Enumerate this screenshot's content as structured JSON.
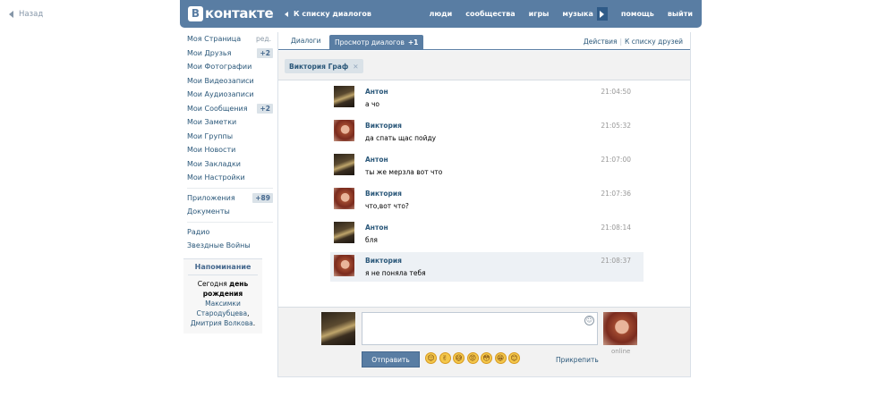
{
  "back": {
    "label": "Назад"
  },
  "header": {
    "logo_letter": "В",
    "logo_text": "контакте",
    "back_link": "К списку диалогов",
    "nav": [
      "люди",
      "сообщества",
      "игры",
      "музыка",
      "помощь",
      "выйти"
    ]
  },
  "sidebar": {
    "items": [
      {
        "label": "Моя Страница",
        "extra": "ред."
      },
      {
        "label": "Мои Друзья",
        "badge": "+2"
      },
      {
        "label": "Мои Фотографии"
      },
      {
        "label": "Мои Видеозаписи"
      },
      {
        "label": "Мои Аудиозаписи"
      },
      {
        "label": "Мои Сообщения",
        "badge": "+2"
      },
      {
        "label": "Мои Заметки"
      },
      {
        "label": "Мои Группы"
      },
      {
        "label": "Мои Новости"
      },
      {
        "label": "Мои Закладки"
      },
      {
        "label": "Мои Настройки"
      }
    ],
    "apps": [
      {
        "label": "Приложения",
        "badge": "+89"
      },
      {
        "label": "Документы"
      }
    ],
    "extra": [
      {
        "label": "Радио"
      },
      {
        "label": "Звездные Войны"
      }
    ],
    "reminder": {
      "title": "Напоминание",
      "pre": "Сегодня ",
      "bold": "день рождения",
      "names": "Максимки Стародубцева",
      "sep": ", ",
      "names2": "Дмитрия Волкова",
      "end": "."
    }
  },
  "tabs": {
    "dialogs": "Диалоги",
    "view": "Просмотр диалогов",
    "view_count": "+1",
    "actions": "Действия",
    "friends": "К списку друзей"
  },
  "peer": {
    "name": "Виктория Граф",
    "close": "✕"
  },
  "messages": [
    {
      "author": "Антон",
      "text": "а чо",
      "time": "21:04:50"
    },
    {
      "author": "Виктория",
      "text": "да спать щас пойду",
      "time": "21:05:32"
    },
    {
      "author": "Антон",
      "text": "ты же мерзла вот что",
      "time": "21:07:00"
    },
    {
      "author": "Виктория",
      "text": "что,вот что?",
      "time": "21:07:36"
    },
    {
      "author": "Антон",
      "text": "бля",
      "time": "21:08:14"
    },
    {
      "author": "Виктория",
      "text": "я не поняла тебя",
      "time": "21:08:37"
    }
  ],
  "compose": {
    "send": "Отправить",
    "attach": "Прикрепить",
    "online": "online",
    "smile": "☺",
    "emojis": [
      "😌",
      "✌",
      "😅",
      "😡",
      "😳",
      "😁",
      "😊"
    ]
  }
}
